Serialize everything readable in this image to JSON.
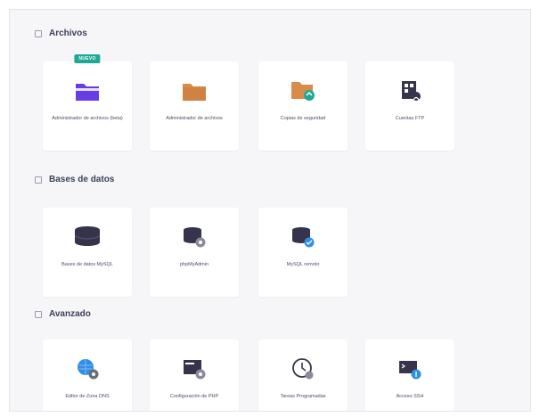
{
  "sections": [
    {
      "title": "Archivos",
      "cards": [
        {
          "label": "Administrador de archivos (beta)",
          "icon": "purple-folder-icon",
          "badge": "NUEVO"
        },
        {
          "label": "Administrador de archivos",
          "icon": "folder-icon"
        },
        {
          "label": "Copias de seguridad",
          "icon": "backup-folder-icon"
        },
        {
          "label": "Cuentas FTP",
          "icon": "ftp-account-icon"
        }
      ]
    },
    {
      "title": "Bases de datos",
      "cards": [
        {
          "label": "Bases de datos MySQL",
          "icon": "database-icon"
        },
        {
          "label": "phpMyAdmin",
          "icon": "database-gear-icon"
        },
        {
          "label": "MySQL remoto",
          "icon": "database-remote-icon"
        }
      ]
    },
    {
      "title": "Avanzado",
      "cards": [
        {
          "label": "Editor de Zona DNS",
          "icon": "dns-gear-icon"
        },
        {
          "label": "Configuración de PHP",
          "icon": "php-config-icon"
        },
        {
          "label": "Tareas Programadas",
          "icon": "clock-icon"
        },
        {
          "label": "Acceso SSH",
          "icon": "ssh-terminal-icon"
        }
      ]
    }
  ],
  "colors": {
    "panel_bg": "#f6f6f9",
    "badge": "#1ea895",
    "purple": "#673de6",
    "orange": "#d98b4a",
    "blue": "#2f8fe8",
    "dark": "#36344d"
  }
}
